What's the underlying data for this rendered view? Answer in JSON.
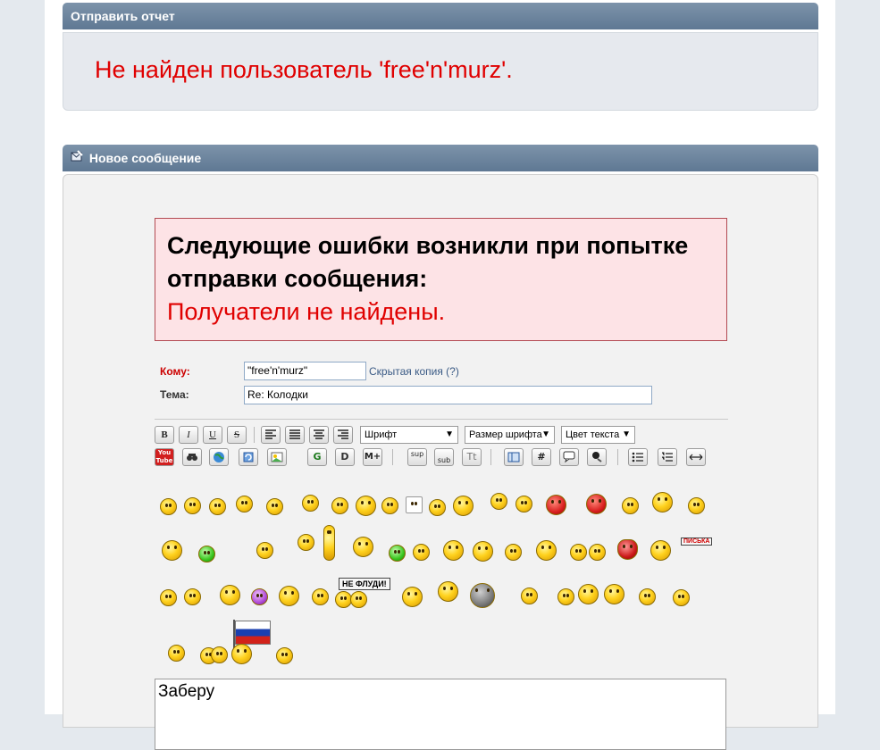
{
  "report": {
    "header": "Отправить отчет",
    "message": "Не найден пользователь 'free'n'murz'."
  },
  "new_message": {
    "header": "Новое сообщение",
    "error": {
      "title": "Следующие ошибки возникли при попытке отправки сообщения:",
      "detail": "Получатели не найдены."
    },
    "form": {
      "to_label": "Кому:",
      "to_value": "\"free'n'murz\"",
      "bcc_link": "Скрытая копия (?)",
      "subject_label": "Тема:",
      "subject_value": "Re: Колодки"
    },
    "toolbar": {
      "bold": "B",
      "italic": "I",
      "underline": "U",
      "strike": "S",
      "font_select": "Шрифт",
      "size_select": "Размер шрифта",
      "color_select": "Цвет текста",
      "sup": "sup",
      "sub": "sub",
      "tt": "Tt",
      "hash": "#",
      "mplus": "M+",
      "youtube": "You Tube"
    },
    "smileys": {
      "sign_text": "НЕ ФЛУДИ!",
      "tag_text": "ПИСЬКА"
    },
    "body_text": "Заберу"
  }
}
